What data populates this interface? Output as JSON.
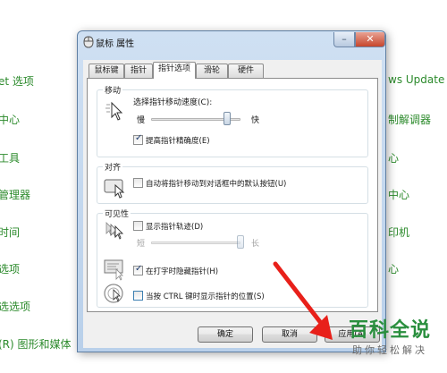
{
  "background": {
    "left_items": [
      "et 选项",
      "中心",
      "工具",
      "管理器",
      "时间",
      "选项",
      "选选项",
      "(R) 图形和媒体"
    ],
    "right_items": [
      "ws Update",
      "制解调器",
      "心",
      "中心",
      "印机",
      "心"
    ]
  },
  "dialog": {
    "title": "鼠标 属性",
    "minimize_glyph": "–",
    "close_glyph": "✕",
    "tabs": [
      "鼠标键",
      "指针",
      "指针选项",
      "滑轮",
      "硬件"
    ],
    "active_tab": "指针选项",
    "motion": {
      "group_label": "移动",
      "speed_label": "选择指针移动速度(C):",
      "slow": "慢",
      "fast": "快",
      "speed_level": 0.85,
      "precision_label": "提高指针精确度(E)",
      "precision_checked": true
    },
    "snap": {
      "group_label": "对齐",
      "snap_label": "自动将指针移动到对话框中的默认按钮(U)",
      "snap_checked": false
    },
    "visibility": {
      "group_label": "可见性",
      "trails_label": "显示指针轨迹(D)",
      "trails_checked": false,
      "short": "短",
      "long": "长",
      "trails_level": 1.0,
      "hide_label": "在打字时隐藏指针(H)",
      "hide_checked": true,
      "ctrl_label": "当按 CTRL 键时显示指针的位置(S)",
      "ctrl_checked": false
    },
    "buttons": {
      "ok": "确定",
      "cancel": "取消",
      "apply": "应用(A)"
    }
  },
  "watermark": {
    "title": "百科全说",
    "subtitle": "助你轻松解决"
  },
  "colors": {
    "link_green": "#2b8a2b",
    "arrow_red": "#e8201a",
    "watermark_green": "#2a8f3e"
  }
}
